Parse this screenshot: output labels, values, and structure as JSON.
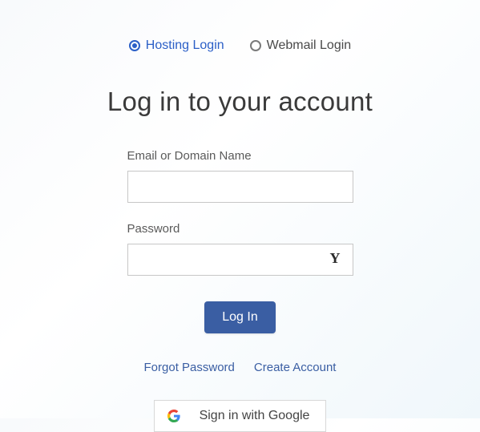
{
  "tabs": {
    "hosting": "Hosting Login",
    "webmail": "Webmail Login"
  },
  "heading": "Log in to your account",
  "form": {
    "email_label": "Email or Domain Name",
    "email_value": "",
    "password_label": "Password",
    "password_value": ""
  },
  "buttons": {
    "login": "Log In",
    "google": "Sign in with Google"
  },
  "links": {
    "forgot": "Forgot Password",
    "create": "Create Account"
  }
}
